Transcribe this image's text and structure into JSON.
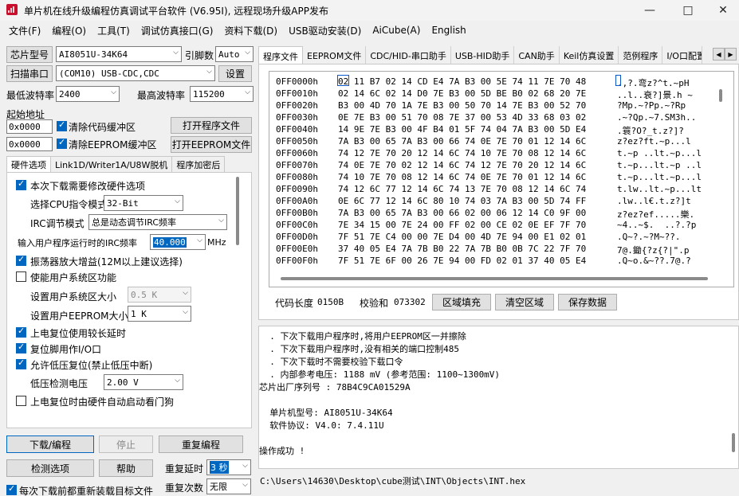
{
  "window": {
    "title": "单片机在线升级编程仿真调试平台软件 (V6.95I), 远程现场升级APP发布"
  },
  "menu": [
    "文件(F)",
    "编程(O)",
    "工具(T)",
    "调试仿真接口(G)",
    "资料下载(D)",
    "USB驱动安装(D)",
    "AiCube(A)",
    "English"
  ],
  "left": {
    "chip_label": "芯片型号",
    "chip_value": "AI8051U-34K64",
    "freq_label": "引脚数",
    "freq_value": "Auto",
    "scan_button": "扫描串口",
    "port_value": "(COM10) USB-CDC,CDC",
    "settings_button": "设置",
    "min_baud_label": "最低波特率",
    "min_baud_value": "2400",
    "max_baud_label": "最高波特率",
    "max_baud_value": "115200",
    "start_addr_label": "起始地址",
    "addr1": "0x0000",
    "addr2": "0x0000",
    "clear_code_label": "清除代码缓冲区",
    "clear_eeprom_label": "清除EEPROM缓冲区",
    "open_prog_button": "打开程序文件",
    "open_eeprom_button": "打开EEPROM文件",
    "tabs": [
      "硬件选项",
      "Link1D/Writer1A/U8W脱机",
      "程序加密后"
    ],
    "hw": {
      "opt_modify": "本次下载需要修改硬件选项",
      "cpu_mode_label": "选择CPU指令模式",
      "cpu_mode_value": "32-Bit",
      "irc_mode_label": "IRC调节模式",
      "irc_mode_value": "总是动态调节IRC频率",
      "irc_freq_label": "输入用户程序运行时的IRC频率",
      "irc_freq_value": "40.000",
      "irc_unit": "MHz",
      "osc_gain": "振荡器放大增益(12M以上建议选择)",
      "use_sys_area": "使能用户系统区功能",
      "sys_size_label": "设置用户系统区大小",
      "sys_size_value": "0.5 K",
      "eeprom_size_label": "设置用户EEPROM大小",
      "eeprom_size_value": "1   K",
      "long_delay": "上电复位使用较长延时",
      "reset_io": "复位脚用作I/O口",
      "low_volt_reset": "允许低压复位(禁止低压中断)",
      "low_volt_label": "低压检测电压",
      "low_volt_value": "2.00 V",
      "watchdog": "上电复位时由硬件自动启动看门狗"
    },
    "download_button": "下载/编程",
    "stop_button": "停止",
    "reprogram_button": "重复编程",
    "detect_button": "检测选项",
    "help_button": "帮助",
    "repeat_delay_label": "重复延时",
    "repeat_delay_value": "3 秒",
    "repeat_count_label": "重复次数",
    "repeat_count_value": "无限",
    "reload_label": "每次下载前都重新装载目标文件"
  },
  "right": {
    "tabs": [
      "程序文件",
      "EEPROM文件",
      "CDC/HID-串口助手",
      "USB-HID助手",
      "CAN助手",
      "Keil仿真设置",
      "范例程序",
      "I/O口配置"
    ],
    "hex_rows": [
      {
        "addr": "0FF0000h",
        "bytes": "02 11 B7 02 14 CD E4 7A B3 00 5E 74 11 7E 70 48",
        "ascii": ".,?.弯z?^t.~pH"
      },
      {
        "addr": "0FF0010h",
        "bytes": "02 14 6C 02 14 D0 7E B3 00 5D BE B0 02 68 20 7E",
        "ascii": "..l..衰?]景.h ~"
      },
      {
        "addr": "0FF0020h",
        "bytes": "B3 00 4D 70 1A 7E B3 00 50 70 14 7E B3 00 52 70",
        "ascii": "?Mp.~?Pp.~?Rp"
      },
      {
        "addr": "0FF0030h",
        "bytes": "0E 7E B3 00 51 70 08 7E 37 00 53 4D 33 68 03 02",
        "ascii": ".~?Qp.~7.SM3h.."
      },
      {
        "addr": "0FF0040h",
        "bytes": "14 9E 7E B3 00 4F B4 01 5F 74 04 7A B3 00 5D E4",
        "ascii": ".簑?O?_t.z?]?"
      },
      {
        "addr": "0FF0050h",
        "bytes": "7A B3 00 65 7A B3 00 66 74 0E 7E 70 01 12 14 6C",
        "ascii": "z?ez?ft.~p...l"
      },
      {
        "addr": "0FF0060h",
        "bytes": "74 12 7E 70 20 12 14 6C 74 10 7E 70 08 12 14 6C",
        "ascii": "t.~p ..lt.~p...l"
      },
      {
        "addr": "0FF0070h",
        "bytes": "74 0E 7E 70 02 12 14 6C 74 12 7E 70 20 12 14 6C",
        "ascii": "t.~p...lt.~p ..l"
      },
      {
        "addr": "0FF0080h",
        "bytes": "74 10 7E 70 08 12 14 6C 74 0E 7E 70 01 12 14 6C",
        "ascii": "t.~p...lt.~p...l"
      },
      {
        "addr": "0FF0090h",
        "bytes": "74 12 6C 77 12 14 6C 74 13 7E 70 08 12 14 6C 74",
        "ascii": "t.lw..lt.~p...lt"
      },
      {
        "addr": "0FF00A0h",
        "bytes": "0E 6C 77 12 14 6C 80 10 74 03 7A B3 00 5D 74 FF",
        "ascii": ".lw..l€.t.z?]t"
      },
      {
        "addr": "0FF00B0h",
        "bytes": "7A B3 00 65 7A B3 00 66 02 00 06 12 14 C0 9F 00",
        "ascii": "z?ez?ef.....樂."
      },
      {
        "addr": "0FF00C0h",
        "bytes": "7E 34 15 00 7E 24 00 FF 02 00 CE 02 0E EF 7F 70",
        "ascii": "~4..~$.  ..?.?p"
      },
      {
        "addr": "0FF00D0h",
        "bytes": "7F 51 7E C4 00 00 7E D4 00 4D 7E 94 00 E1 02 01",
        "ascii": ".Q~?.~?M~??."
      },
      {
        "addr": "0FF00E0h",
        "bytes": "37 40 05 E4 7A 7B B0 22 7A 7B B0 0B 7C 22 7F 70",
        "ascii": "7@.鋤{?z{?|\".p"
      },
      {
        "addr": "0FF00F0h",
        "bytes": "7F 51 7E 6F 00 26 7E 94 00 FD 02 01 37 40 05 E4",
        "ascii": ".Q~o.&~??.7@.?"
      }
    ],
    "code_len_label": "代码长度",
    "code_len_value": "0150B",
    "checksum_label": "校验和",
    "checksum_value": "073302",
    "fill_button": "区域填充",
    "clear_button": "清空区域",
    "save_button": "保存数据"
  },
  "log": [
    "  . 下次下载用户程序时,将用户EEPROM区一并擦除",
    "  . 下次下载用户程序时,没有相关的端口控制485",
    "  . 下次下载时不需要校验下载口令",
    "  . 内部参考电压: 1188 mV (参考范围: 1100~1300mV)",
    "芯片出厂序列号 : 78B4C9CA01529A",
    "",
    "  单片机型号: AI8051U-34K64",
    "  软件协议: V4.0: 7.4.11U",
    "",
    "操作成功 !"
  ],
  "path": "C:\\Users\\14630\\Desktop\\cube测试\\INT\\Objects\\INT.hex"
}
